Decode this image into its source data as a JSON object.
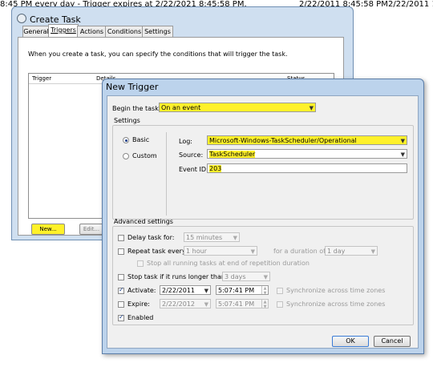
{
  "status_strip": {
    "left_text": "8:45 PM every day - Trigger expires at 2/22/2021 8:45:58 PM.",
    "right_text_1": "2/22/2011 8:45:58 PM",
    "right_text_2": "2/22/2011 1"
  },
  "create_task": {
    "title": "Create Task",
    "tabs": [
      "General",
      "Triggers",
      "Actions",
      "Conditions",
      "Settings"
    ],
    "description": "When you create a task, you can specify the conditions that will trigger the task.",
    "columns": [
      "Trigger",
      "Details",
      "Status"
    ],
    "new_button": "New...",
    "edit_button": "Edit..."
  },
  "new_trigger": {
    "title": "New Trigger",
    "begin_label": "Begin the task:",
    "begin_value": "On an event",
    "settings_label": "Settings",
    "radio_basic": "Basic",
    "radio_custom": "Custom",
    "log_label": "Log:",
    "log_value": "Microsoft-Windows-TaskScheduler/Operational",
    "source_label": "Source:",
    "source_value": "TaskScheduler",
    "eventid_label": "Event ID:",
    "eventid_value": "203",
    "advanced_label": "Advanced settings",
    "delay_label": "Delay task for:",
    "delay_value": "15 minutes",
    "repeat_label": "Repeat task every:",
    "repeat_value": "1 hour",
    "duration_label": "for a duration of:",
    "duration_value": "1 day",
    "stop_running_label": "Stop all running tasks at end of repetition duration",
    "stop_longer_label": "Stop task if it runs longer than:",
    "stop_longer_value": "3 days",
    "activate_label": "Activate:",
    "activate_date": "2/22/2011",
    "activate_time": "5:07:41 PM",
    "expire_label": "Expire:",
    "expire_date": "2/22/2012",
    "expire_time": "5:07:41 PM",
    "sync_label": "Synchronize across time zones",
    "enabled_label": "Enabled",
    "ok_button": "OK",
    "cancel_button": "Cancel"
  }
}
